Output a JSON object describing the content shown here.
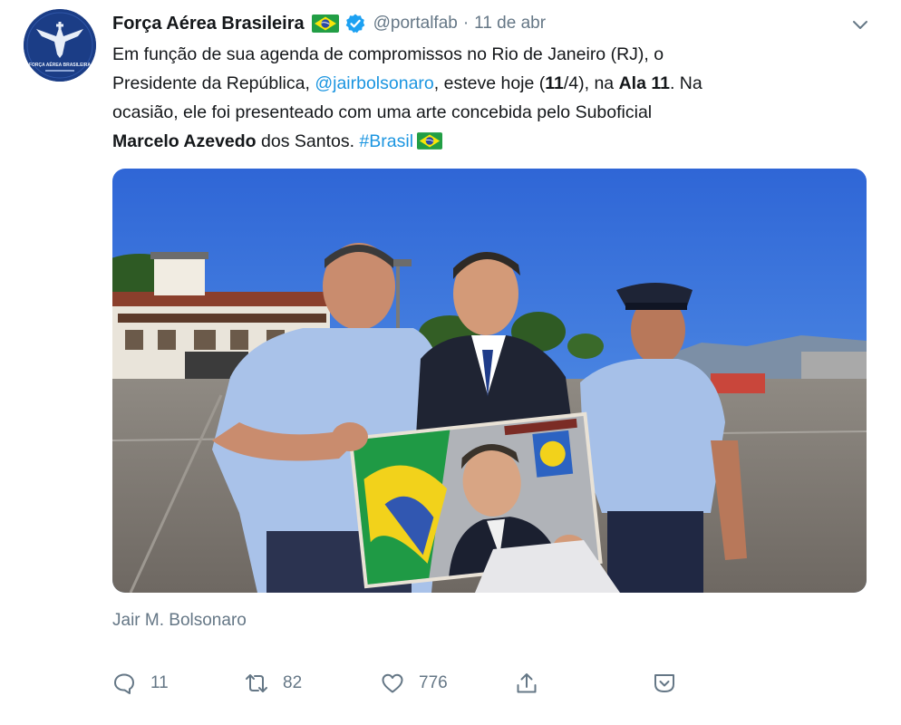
{
  "account": {
    "display_name": "Força Aérea Brasileira",
    "handle": "@portalfab",
    "separator": "·",
    "date": "11 de abr",
    "avatar_logo_text": "FORÇA AÉREA BRASILEIRA"
  },
  "tweet": {
    "line1": "Em função de sua agenda de compromissos no Rio de Janeiro (RJ), o",
    "line2_a": "Presidente da República, ",
    "line2_mention": "@jairbolsonaro",
    "line2_b": ", esteve hoje (",
    "line2_bold1": "11",
    "line2_c": "/4), na ",
    "line2_bold2": "Ala 11",
    "line2_d": ". Na",
    "line3": "ocasião, ele foi presenteado com uma arte concebida pelo Suboficial",
    "line4_bold": "Marcelo Azevedo",
    "line4_a": " dos Santos. ",
    "line4_hashtag": "#Brasil"
  },
  "photo": {
    "tagged_user": "Jair M. Bolsonaro"
  },
  "actions": {
    "reply_count": "11",
    "retweet_count": "82",
    "like_count": "776"
  },
  "colors": {
    "text": "#14171a",
    "secondary": "#657786",
    "link": "#1b95e0",
    "verified": "#1da1f2"
  },
  "icons": {
    "avatar": "fab-logo-icon",
    "flag": "brazil-flag-icon",
    "verified": "verified-badge-icon",
    "more": "chevron-down-icon",
    "reply": "reply-icon",
    "retweet": "retweet-icon",
    "like": "heart-icon",
    "share": "share-icon",
    "analytics": "analytics-icon"
  }
}
